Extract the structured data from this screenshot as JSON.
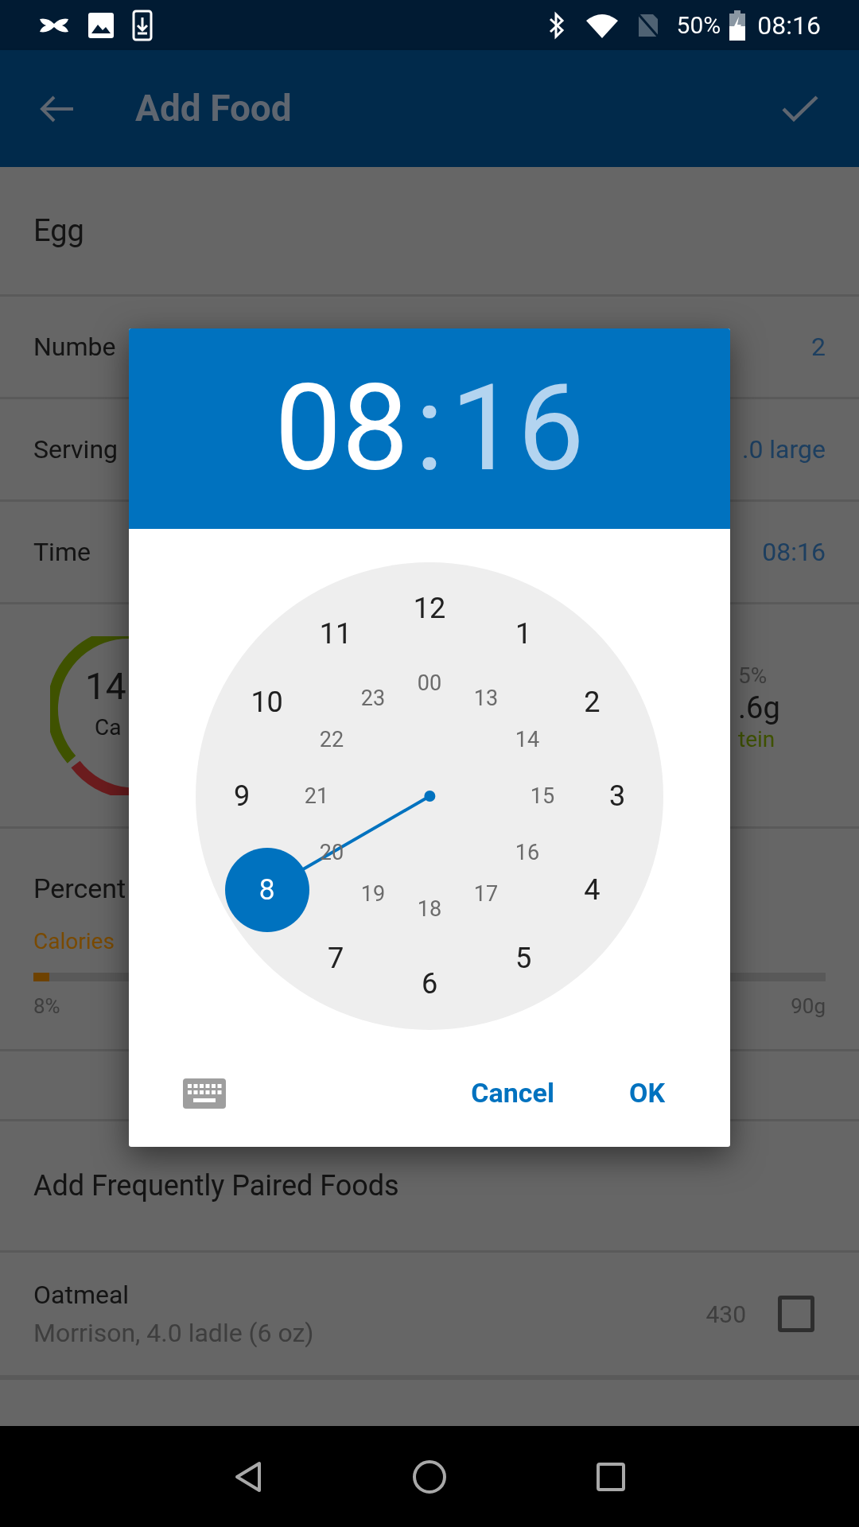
{
  "status_bar": {
    "battery": "50%",
    "time": "08:16"
  },
  "app_bar": {
    "title": "Add Food"
  },
  "food_name": "Egg",
  "rows": [
    {
      "label": "Numbe",
      "value": "2"
    },
    {
      "label": "Serving",
      "value": ".0 large"
    },
    {
      "label": "Time",
      "value": "08:16"
    }
  ],
  "macros": {
    "left_value": "14",
    "left_label": "Ca",
    "right_percent": "5%",
    "right_value": ".6g",
    "right_label": "tein"
  },
  "percent": {
    "title": "Percent",
    "label": "Calories",
    "level": 0.02,
    "left_reading": "8%",
    "right_reading": "90g"
  },
  "paired": {
    "title": "Add Frequently Paired Foods",
    "items": [
      {
        "name": "Oatmeal",
        "detail": "Morrison, 4.0 ladle (6 oz)",
        "calories": "430",
        "checked": false
      }
    ]
  },
  "dialog": {
    "hours": {
      "text": "08",
      "selected": true
    },
    "separator": ":",
    "minutes": {
      "text": "16",
      "selected": false
    },
    "outer": [
      {
        "label": "12",
        "selected": false
      },
      {
        "label": "1",
        "selected": false
      },
      {
        "label": "2",
        "selected": false
      },
      {
        "label": "3",
        "selected": false
      },
      {
        "label": "4",
        "selected": false
      },
      {
        "label": "5",
        "selected": false
      },
      {
        "label": "6",
        "selected": false
      },
      {
        "label": "7",
        "selected": false
      },
      {
        "label": "8",
        "selected": true
      },
      {
        "label": "9",
        "selected": false
      },
      {
        "label": "10",
        "selected": false
      },
      {
        "label": "11",
        "selected": false
      }
    ],
    "inner": [
      {
        "label": "00",
        "selected": false
      },
      {
        "label": "13",
        "selected": false
      },
      {
        "label": "14",
        "selected": false
      },
      {
        "label": "15",
        "selected": false
      },
      {
        "label": "16",
        "selected": false
      },
      {
        "label": "17",
        "selected": false
      },
      {
        "label": "18",
        "selected": false
      },
      {
        "label": "19",
        "selected": false
      },
      {
        "label": "20",
        "selected": false
      },
      {
        "label": "21",
        "selected": false
      },
      {
        "label": "22",
        "selected": false
      },
      {
        "label": "23",
        "selected": false
      }
    ],
    "buttons": [
      "Cancel",
      "OK"
    ]
  }
}
